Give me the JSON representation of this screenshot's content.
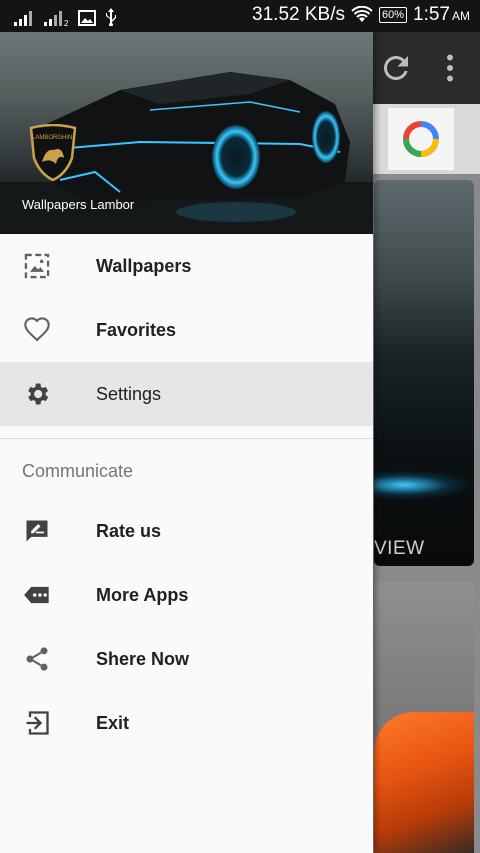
{
  "status_bar": {
    "network_speed": "31.52 KB/s",
    "battery": "60%",
    "time": "1:57",
    "time_suffix": "AM"
  },
  "drawer": {
    "header_title": "Wallpapers Lambor",
    "logo_text": "LAMBORGHINI",
    "items": [
      {
        "label": "Wallpapers",
        "icon": "wallpaper-icon",
        "active": false
      },
      {
        "label": "Favorites",
        "icon": "heart-icon",
        "active": false
      },
      {
        "label": "Settings",
        "icon": "gear-icon",
        "active": true
      }
    ],
    "section_title": "Communicate",
    "communicate_items": [
      {
        "label": "Rate us",
        "icon": "rate-feedback-icon"
      },
      {
        "label": "More Apps",
        "icon": "more-apps-icon"
      },
      {
        "label": "Shere Now",
        "icon": "share-icon"
      },
      {
        "label": "Exit",
        "icon": "exit-icon"
      }
    ]
  },
  "background": {
    "card_label_partial": "VIEW"
  },
  "colors": {
    "drawer_bg": "#fafafa",
    "active_item_bg": "#e6e6e6",
    "statusbar_bg": "#141414",
    "accent_blue": "#3cc9ff"
  }
}
